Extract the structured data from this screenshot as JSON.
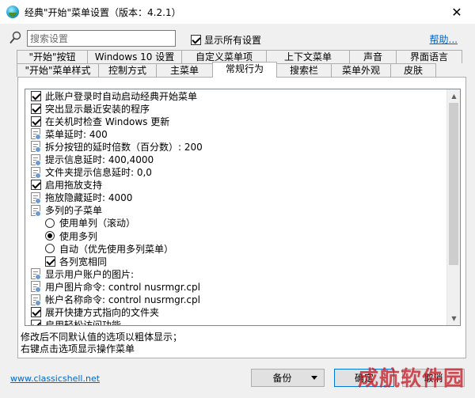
{
  "window": {
    "title": "经典\"开始\"菜单设置（版本：4.2.1）",
    "close_glyph": "✕"
  },
  "toolbar": {
    "search_placeholder": "搜索设置",
    "search_value": "",
    "show_all_label": "显示所有设置",
    "show_all_checked": true,
    "help_label": "帮助..."
  },
  "tabs": {
    "row1": [
      {
        "label": "\"开始\"按钮",
        "w": 90
      },
      {
        "label": "Windows 10 设置",
        "w": 120
      },
      {
        "label": "自定义菜单项",
        "w": 108
      },
      {
        "label": "上下文菜单",
        "w": 106
      },
      {
        "label": "声音",
        "w": 60
      },
      {
        "label": "界面语言",
        "w": 84
      }
    ],
    "row2": [
      {
        "label": "\"开始\"菜单样式",
        "w": 104
      },
      {
        "label": "控制方式",
        "w": 74
      },
      {
        "label": "主菜单",
        "w": 72
      },
      {
        "label": "常规行为",
        "w": 82,
        "active": true
      },
      {
        "label": "搜索栏",
        "w": 70
      },
      {
        "label": "菜单外观",
        "w": 76
      },
      {
        "label": "皮肤",
        "w": 58
      }
    ]
  },
  "settings": [
    {
      "control": "checkbox",
      "checked": true,
      "indent": 0,
      "label": "此账户登录时自动启动经典开始菜单"
    },
    {
      "control": "checkbox",
      "checked": true,
      "indent": 0,
      "label": "突出显示最近安装的程序"
    },
    {
      "control": "checkbox",
      "checked": true,
      "indent": 0,
      "label": "在关机时检查 Windows 更新"
    },
    {
      "control": "doc",
      "indent": 0,
      "label": "菜单延时: 400"
    },
    {
      "control": "doc",
      "indent": 0,
      "label": "拆分按钮的延时倍数（百分数）: 200"
    },
    {
      "control": "doc",
      "indent": 0,
      "label": "提示信息延时: 400,4000"
    },
    {
      "control": "doc",
      "indent": 0,
      "label": "文件夹提示信息延时: 0,0"
    },
    {
      "control": "checkbox",
      "checked": true,
      "indent": 0,
      "label": "启用拖放支持"
    },
    {
      "control": "doc",
      "indent": 0,
      "label": "拖放隐藏延时: 4000"
    },
    {
      "control": "doc",
      "indent": 0,
      "label": "多列的子菜单"
    },
    {
      "control": "radio",
      "checked": false,
      "indent": 1,
      "label": "使用单列（滚动）"
    },
    {
      "control": "radio",
      "checked": true,
      "indent": 1,
      "label": "使用多列"
    },
    {
      "control": "radio",
      "checked": false,
      "indent": 1,
      "label": "自动（优先使用多列菜单）"
    },
    {
      "control": "checkbox",
      "checked": true,
      "indent": 1,
      "label": "各列宽相同"
    },
    {
      "control": "doc",
      "indent": 0,
      "label": "显示用户账户的图片:"
    },
    {
      "control": "doc",
      "indent": 0,
      "label": "用户图片命令: control nusrmgr.cpl"
    },
    {
      "control": "doc",
      "indent": 0,
      "label": "帐户名称命令: control nusrmgr.cpl"
    },
    {
      "control": "checkbox",
      "checked": true,
      "indent": 0,
      "label": "展开快捷方式指向的文件夹"
    },
    {
      "control": "checkbox",
      "checked": true,
      "indent": 0,
      "label": "启用轻松访问功能"
    }
  ],
  "hints": {
    "line1": "修改后不同默认值的选项以粗体显示；",
    "line2": "右键点击选项显示操作菜单"
  },
  "footer": {
    "website": "www.classicshell.net",
    "backup_label": "备份",
    "ok_label": "确定",
    "cancel_label": "取消"
  },
  "watermark": "成航软件园",
  "colors": {
    "link": "#0066cc",
    "window_bg": "#f0f0f0",
    "focus_border": "#0078d7",
    "watermark": "#c81e28"
  }
}
